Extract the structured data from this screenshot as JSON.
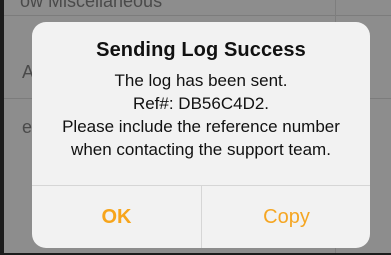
{
  "background": {
    "rows": [
      "ow Miscellaneous",
      "A",
      "e"
    ]
  },
  "alert": {
    "title": "Sending Log Success",
    "message_lines": [
      "The log has been sent.",
      "Ref#: DB56C4D2.",
      "Please include the reference number",
      "when contacting the support team."
    ],
    "buttons": {
      "ok": "OK",
      "copy": "Copy"
    }
  },
  "colors": {
    "accent": "#f5a623",
    "alert_bg": "#f2f2f2",
    "overlay": "#7a7a7a"
  }
}
